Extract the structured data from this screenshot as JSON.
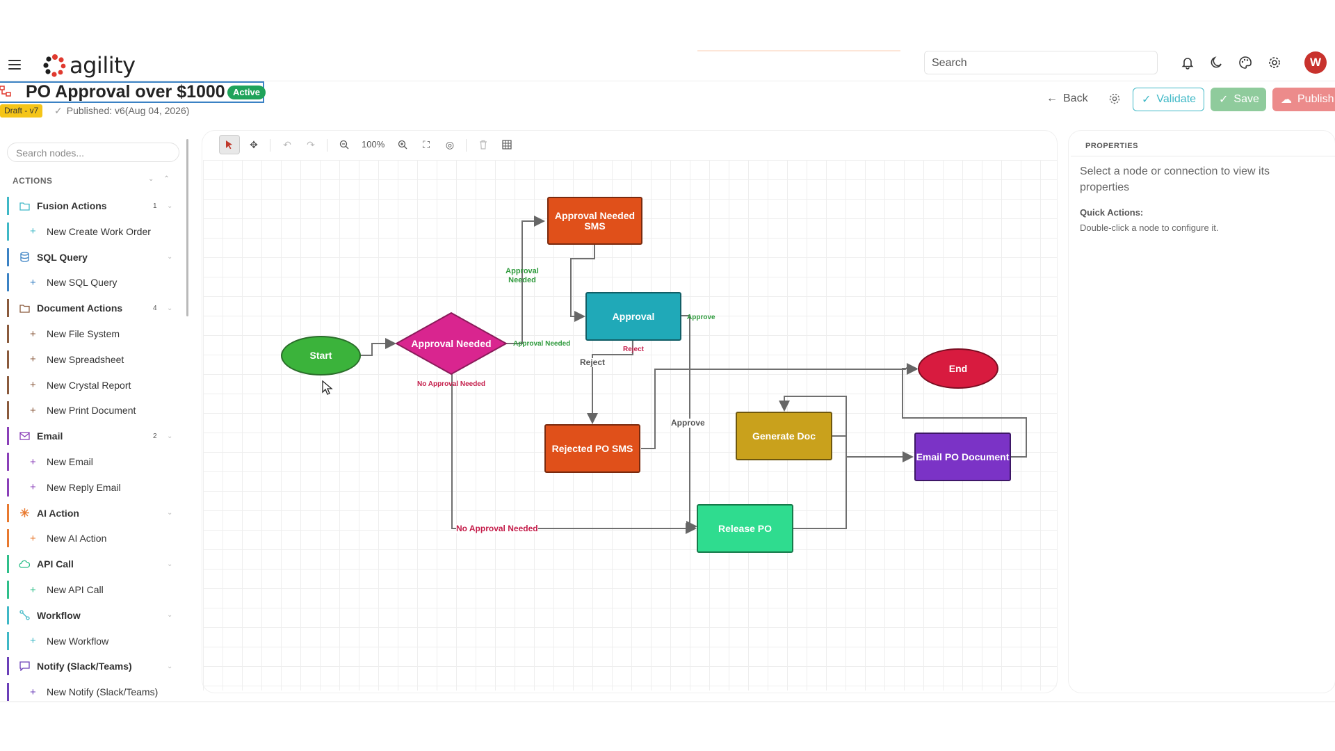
{
  "header": {
    "logo_text": "agility",
    "search_placeholder": "Search",
    "avatar_letter": "W",
    "icons": [
      "menu-icon",
      "bell-icon",
      "moon-icon",
      "palette-icon",
      "gear-icon"
    ]
  },
  "workflow": {
    "title": "PO Approval over $1000",
    "status": "Active",
    "draft": "Draft - v7",
    "published": "Published: v6(Aug 04, 2026)"
  },
  "actions_bar": {
    "back": "Back",
    "validate": "Validate",
    "save": "Save",
    "publish": "Publish"
  },
  "sidebar": {
    "search_placeholder": "Search nodes...",
    "section_title": "ACTIONS",
    "categories": [
      {
        "label": "Fusion Actions",
        "count": "1",
        "color": "#3fb8c6",
        "icon": "folder-icon",
        "items": [
          "New Create Work Order"
        ]
      },
      {
        "label": "SQL Query",
        "count": "",
        "color": "#3b82c4",
        "icon": "database-icon",
        "items": [
          "New SQL Query"
        ]
      },
      {
        "label": "Document Actions",
        "count": "4",
        "color": "#8a5a3c",
        "icon": "folder-icon",
        "items": [
          "New File System",
          "New Spreadsheet",
          "New Crystal Report",
          "New Print Document"
        ]
      },
      {
        "label": "Email",
        "count": "2",
        "color": "#8a3fb8",
        "icon": "mail-icon",
        "items": [
          "New Email",
          "New Reply Email"
        ]
      },
      {
        "label": "AI Action",
        "count": "",
        "color": "#e8792f",
        "icon": "sparkle-icon",
        "items": [
          "New AI Action"
        ]
      },
      {
        "label": "API Call",
        "count": "",
        "color": "#2fbf8a",
        "icon": "cloud-icon",
        "items": [
          "New API Call"
        ]
      },
      {
        "label": "Workflow",
        "count": "",
        "color": "#3fb8c6",
        "icon": "workflow-icon",
        "items": [
          "New Workflow"
        ]
      },
      {
        "label": "Notify (Slack/Teams)",
        "count": "",
        "color": "#6b3fb8",
        "icon": "chat-icon",
        "items": [
          "New Notify (Slack/Teams)"
        ]
      }
    ]
  },
  "toolbar": {
    "zoom": "100%",
    "icons": [
      "pointer-icon",
      "move-icon",
      "undo-icon",
      "redo-icon",
      "zoom-out-icon",
      "zoom-in-icon",
      "fit-screen-icon",
      "target-icon",
      "delete-icon",
      "grid-icon"
    ]
  },
  "flow": {
    "nodes": {
      "start": "Start",
      "decision": "Approval Needed",
      "sms": "Approval Needed SMS",
      "approval": "Approval",
      "end": "End",
      "rejected": "Rejected PO SMS",
      "gendoc": "Generate Doc",
      "email": "Email PO Document",
      "release": "Release PO"
    },
    "labels": {
      "approval_needed_1": "Approval Needed",
      "approval_needed_2": "Approval Needed",
      "no_approval_1": "No Approval Needed",
      "no_approval_2": "No Approval Needed",
      "approve_1": "Approve",
      "approve_2": "Approve",
      "reject_1": "Reject",
      "reject_2": "Reject"
    },
    "colors": {
      "start": "#3bb33b",
      "decision": "#d9258f",
      "sms": "#e0501a",
      "approval": "#20a9b8",
      "end": "#d81b3f",
      "rejected": "#e0501a",
      "gendoc": "#c9a11c",
      "email": "#7b33c6",
      "release": "#2fdc8f"
    }
  },
  "properties": {
    "title": "PROPERTIES",
    "message": "Select a node or connection to view its properties",
    "quick_title": "Quick Actions:",
    "quick_text": "Double-click a node to configure it."
  }
}
